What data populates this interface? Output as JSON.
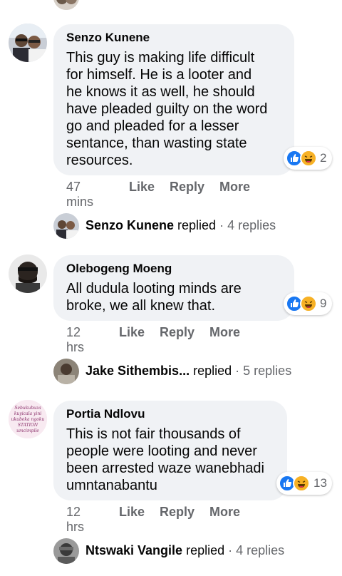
{
  "comments": [
    {
      "author": "Senzo Kunene",
      "lines": [
        "This guy is making life difficult",
        "for himself. He is a looter and",
        "he knows it as well, he should",
        "have pleaded guilty on the word",
        "go and pleaded for a lesser",
        "sentance, than wasting state",
        "resources."
      ],
      "time": "47 mins",
      "like_label": "Like",
      "reply_label": "Reply",
      "more_label": "More",
      "reaction_count": "2",
      "replies_row": {
        "name": "Senzo Kunene",
        "verb": "replied",
        "count": "· 4 replies"
      }
    },
    {
      "author": "Olebogeng Moeng",
      "lines": [
        "All dudula looting minds are",
        "broke, we all knew that."
      ],
      "time": "12 hrs",
      "like_label": "Like",
      "reply_label": "Reply",
      "more_label": "More",
      "reaction_count": "9",
      "replies_row": {
        "name": "Jake Sithembis...",
        "verb": "replied",
        "count": "· 5 replies"
      }
    },
    {
      "author": "Portia Ndlovu",
      "lines": [
        "This is not fair thousands of",
        "people were looting and never",
        "been arrested waze wanebhadi",
        "umntanabantu"
      ],
      "time": "12 hrs",
      "like_label": "Like",
      "reply_label": "Reply",
      "more_label": "More",
      "reaction_count": "13",
      "replies_row": {
        "name": "Ntswaki Vangile",
        "verb": "replied",
        "count": "· 4 replies"
      }
    }
  ],
  "avatar_text": {
    "portia": [
      "Sebukubuza",
      "kuyicala yini",
      "ukubeka ngoku",
      "STATION",
      "umcimpile"
    ]
  },
  "colors": {
    "bubble": "#f0f2f5",
    "meta": "#65676b",
    "like_blue": "#1877f2",
    "haha_yellow": "#f7b125"
  }
}
